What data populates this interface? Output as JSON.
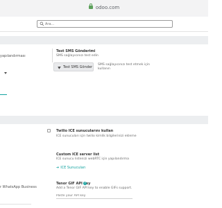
{
  "browser": {
    "url": "odoo.com"
  },
  "search": {
    "placeholder": "Ara..."
  },
  "left_labels": {
    "sms_config": "yapılandırması",
    "whatsapp": "r WhatsApp Business"
  },
  "sms_section": {
    "title": "Test SMS Gönderimi",
    "desc": "SMS sağlayıcınızı test edin",
    "button_label": "Test SMS Gönder",
    "help_line1": "SMS sağlayıcınızı test etmek için",
    "help_line2": "kullanın"
  },
  "ice_twilio": {
    "title": "Twilio ICE sunucularını kullan",
    "desc": "ICE sunucuları için twilio kimlik bilgilerinizi ekleme"
  },
  "ice_custom": {
    "title": "Custom ICE server list",
    "desc": "ICE sunucu listenizi webRTC için yapılandırma",
    "link_label": "ICE Sunucuları"
  },
  "tenor": {
    "title": "Tenor GIF API key",
    "desc": "Add a Tenor GIF API key to enable GIFs support.",
    "input_placeholder": "Paste your API key"
  },
  "colors": {
    "accent": "#12a3a0",
    "section_band": "#eceef0",
    "lock": "#5ca05a"
  },
  "icons": {
    "lock": "lock-icon",
    "search": "search-icon",
    "send": "send-icon",
    "help": "help-icon",
    "arrow": "arrow-right-icon"
  }
}
